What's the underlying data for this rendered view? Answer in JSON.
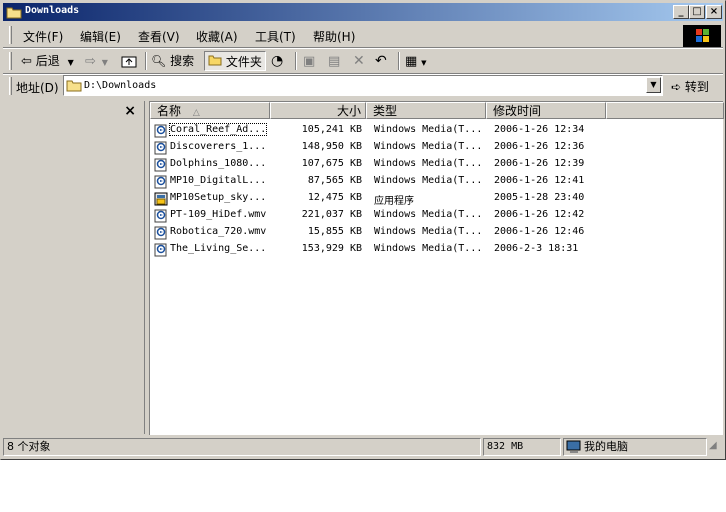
{
  "window": {
    "title": "Downloads"
  },
  "menu": [
    "文件(F)",
    "编辑(E)",
    "查看(V)",
    "收藏(A)",
    "工具(T)",
    "帮助(H)"
  ],
  "toolbar": {
    "back_label": "后退",
    "search_label": "搜索",
    "folders_label": "文件夹"
  },
  "address": {
    "label": "地址(D)",
    "path": "D:\\Downloads",
    "go_label": "转到"
  },
  "columns": {
    "name": "名称",
    "size": "大小",
    "type": "类型",
    "modified": "修改时间"
  },
  "files": [
    {
      "name": "Coral_Reef_Ad...",
      "size": "105,241 KB",
      "type": "Windows Media(T...",
      "modified": "2006-1-26 12:34",
      "icon": "media-file-icon"
    },
    {
      "name": "Discoverers_1...",
      "size": "148,950 KB",
      "type": "Windows Media(T...",
      "modified": "2006-1-26 12:36",
      "icon": "media-file-icon"
    },
    {
      "name": "Dolphins_1080...",
      "size": "107,675 KB",
      "type": "Windows Media(T...",
      "modified": "2006-1-26 12:39",
      "icon": "media-file-icon"
    },
    {
      "name": "MP10_DigitalL...",
      "size": "87,565 KB",
      "type": "Windows Media(T...",
      "modified": "2006-1-26 12:41",
      "icon": "media-file-icon"
    },
    {
      "name": "MP10Setup_sky...",
      "size": "12,475 KB",
      "type": "应用程序",
      "modified": "2005-1-28 23:40",
      "icon": "installer-icon"
    },
    {
      "name": "PT-109_HiDef.wmv",
      "size": "221,037 KB",
      "type": "Windows Media(T...",
      "modified": "2006-1-26 12:42",
      "icon": "media-file-icon"
    },
    {
      "name": "Robotica_720.wmv",
      "size": "15,855 KB",
      "type": "Windows Media(T...",
      "modified": "2006-1-26 12:46",
      "icon": "media-file-icon"
    },
    {
      "name": "The_Living_Se...",
      "size": "153,929 KB",
      "type": "Windows Media(T...",
      "modified": "2006-2-3 18:31",
      "icon": "media-file-icon"
    }
  ],
  "status": {
    "count": "8 个对象",
    "size": "832 MB",
    "location": "我的电脑"
  }
}
